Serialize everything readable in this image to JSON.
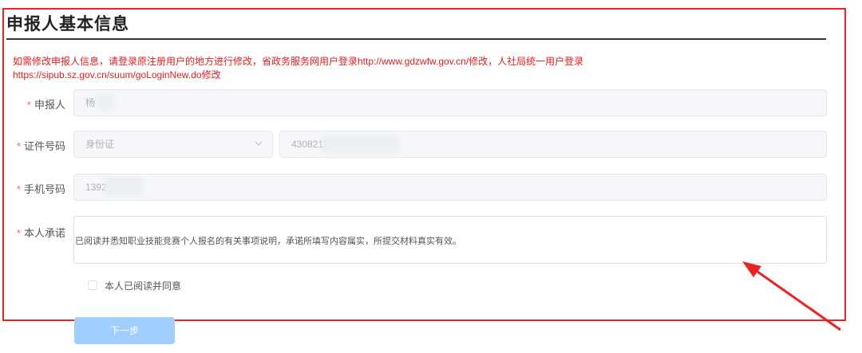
{
  "page": {
    "title": "申报人基本信息",
    "notice_line1": "如需修改申报人信息，请登录原注册用户的地方进行修改，省政务服务网用户登录http://www.gdzwfw.gov.cn/修改，人社局统一用户登录",
    "notice_line2": "https://sipub.sz.gov.cn/suum/goLoginNew.do修改"
  },
  "form": {
    "applicant": {
      "label": "申报人",
      "value": "杨"
    },
    "id_number": {
      "label": "证件号码",
      "type_value": "身份证",
      "number_value": "4308211"
    },
    "phone": {
      "label": "手机号码",
      "value": "1392"
    },
    "promise": {
      "label": "本人承诺",
      "text": "已阅读并悉知职业技能竞赛个人报名的有关事项说明，承诺所填写内容属实，所提交材料真实有效。"
    },
    "agree_label": "本人已阅读并同意",
    "next_button": "下一步",
    "required_mark": "*"
  },
  "colors": {
    "highlight_border": "#ee2222",
    "notice_text": "#e02020",
    "required_star": "#f56c6c",
    "button_disabled": "#a0cfff"
  },
  "icons": [
    "chevron-down-icon",
    "red-annotation-arrow"
  ]
}
